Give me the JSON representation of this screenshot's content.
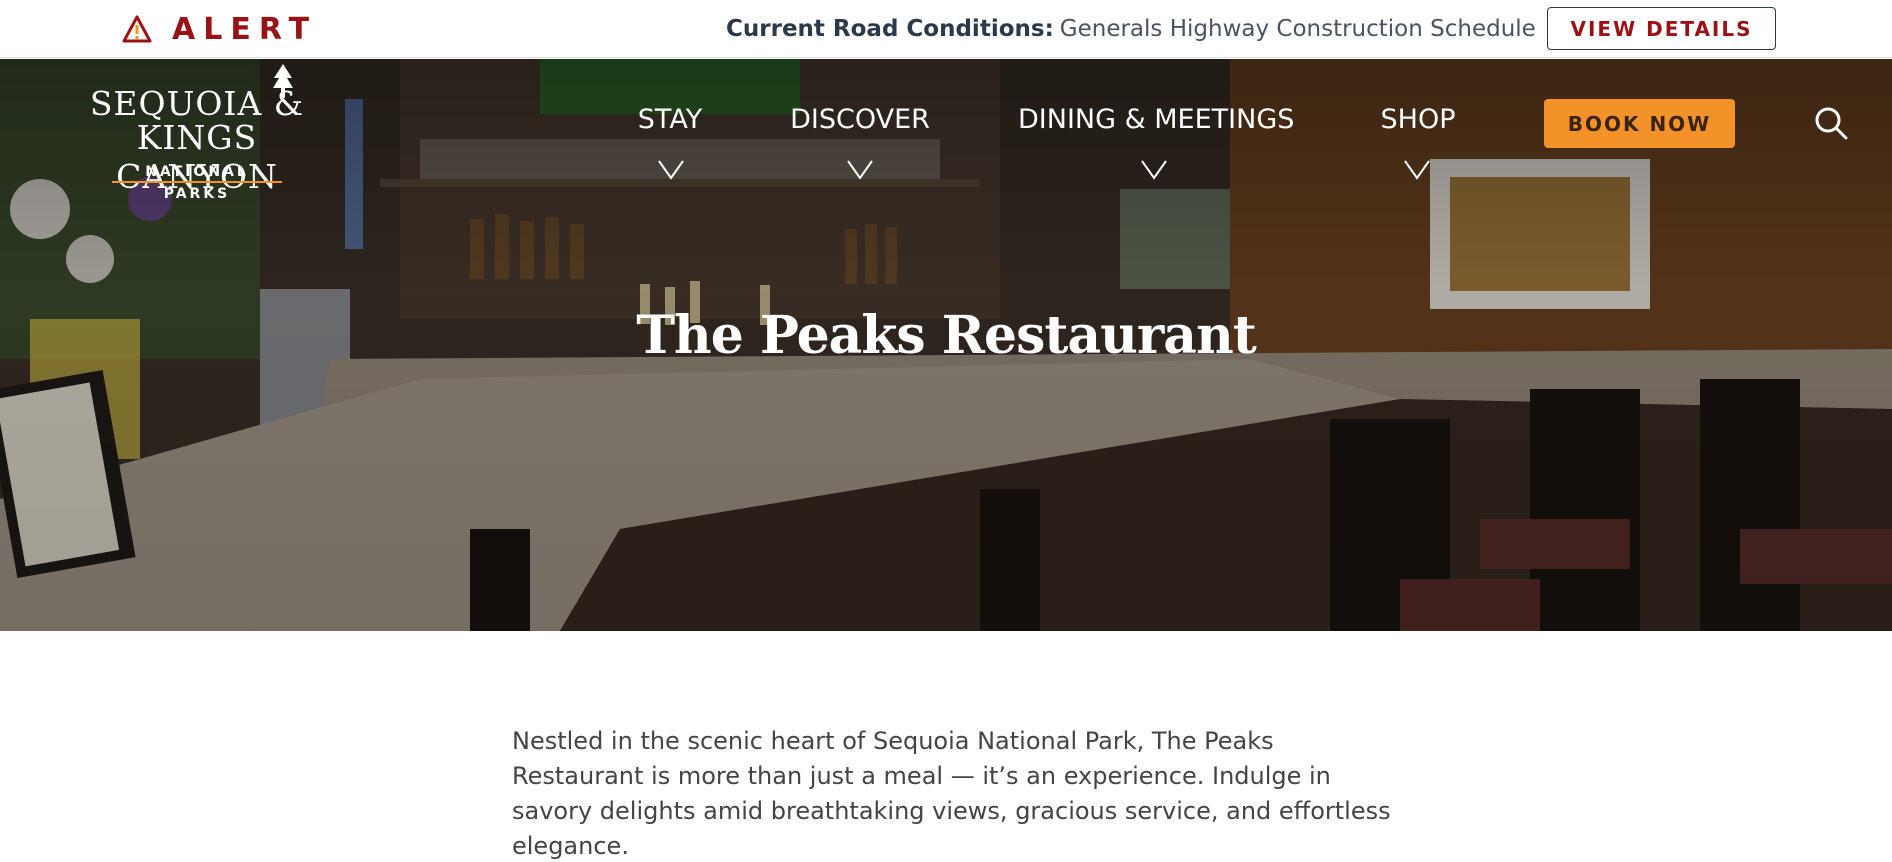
{
  "alert": {
    "word": "ALERT",
    "message_bold": "Current Road Conditions:",
    "message_text": "Generals Highway Construction Schedule",
    "button_label": "VIEW DETAILS"
  },
  "logo": {
    "line1": "SEQUOIA &",
    "line2": "KINGS CANYON",
    "subtitle": "NATIONAL PARKS"
  },
  "nav": {
    "items": [
      {
        "label": "STAY"
      },
      {
        "label": "DISCOVER"
      },
      {
        "label": "DINING & MEETINGS"
      },
      {
        "label": "SHOP"
      }
    ],
    "book_label": "BOOK NOW"
  },
  "hero": {
    "title": "The Peaks Restaurant"
  },
  "intro": {
    "text": "Nestled in the scenic heart of Sequoia National Park, The Peaks Restaurant is more than just a meal — it’s an experience. Indulge in savory delights amid breathtaking views, gracious service, and effortless elegance."
  },
  "colors": {
    "alert_red": "#9b1216",
    "accent_orange": "#f4922a",
    "navy": "#2b3a4a"
  },
  "icons": [
    "warning-icon",
    "search-icon",
    "chevron-down-icon",
    "sequoia-tree-icon"
  ]
}
